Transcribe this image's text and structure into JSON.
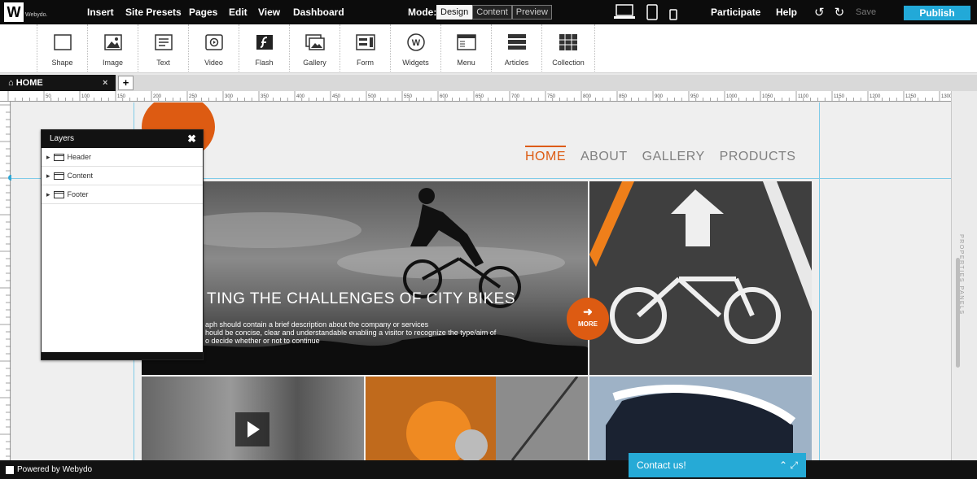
{
  "app": {
    "logo_letter": "W",
    "logo_text": "Webydo.",
    "menu": [
      "Insert",
      "Site Presets",
      "Pages",
      "Edit",
      "View",
      "Dashboard"
    ],
    "mode_label": "Mode:",
    "modes": [
      "Design",
      "Content",
      "Preview"
    ],
    "active_mode": "Design",
    "right_menu": [
      "Participate",
      "Help"
    ],
    "save_label": "Save",
    "publish_label": "Publish"
  },
  "toolbar": {
    "tools": [
      {
        "label": "Shape",
        "icon": "shape-icon"
      },
      {
        "label": "Image",
        "icon": "image-icon"
      },
      {
        "label": "Text",
        "icon": "text-icon"
      },
      {
        "label": "Video",
        "icon": "video-icon"
      },
      {
        "label": "Flash",
        "icon": "flash-icon"
      },
      {
        "label": "Gallery",
        "icon": "gallery-icon"
      },
      {
        "label": "Form",
        "icon": "form-icon"
      },
      {
        "label": "Widgets",
        "icon": "widgets-icon"
      },
      {
        "label": "Menu",
        "icon": "menu-icon"
      },
      {
        "label": "Articles",
        "icon": "articles-icon"
      },
      {
        "label": "Collection",
        "icon": "collection-icon"
      }
    ]
  },
  "tabs": {
    "active": "HOME",
    "close": "×",
    "add": "+"
  },
  "ruler": {
    "ticks": [
      "50",
      "100",
      "150",
      "200",
      "250",
      "300",
      "350",
      "400",
      "450",
      "500",
      "550",
      "600",
      "650",
      "700",
      "750",
      "800",
      "850",
      "900",
      "950",
      "1000",
      "1050",
      "1100",
      "1150",
      "1200",
      "1250",
      "1300"
    ]
  },
  "layers": {
    "title": "Layers",
    "items": [
      "Header",
      "Content",
      "Footer"
    ]
  },
  "site": {
    "nav": [
      "HOME",
      "ABOUT",
      "GALLERY",
      "PRODUCTS"
    ],
    "hero_title": "TING THE CHALLENGES OF CITY BIKES",
    "hero_desc": [
      "aph  should contain a brief description about the company or services",
      "hould be concise, clear and understandable enabling a visitor to recognize the type/aim of",
      "o decide whether or not to continue"
    ],
    "more_label": "MORE"
  },
  "props": {
    "label": "PROPERTIES PANELS"
  },
  "footer": {
    "powered": "Powered by Webydo",
    "contact": "Contact us!"
  },
  "colors": {
    "accent_orange": "#dd5b12",
    "publish_blue": "#22a9d8",
    "contact_blue": "#26aad6"
  }
}
